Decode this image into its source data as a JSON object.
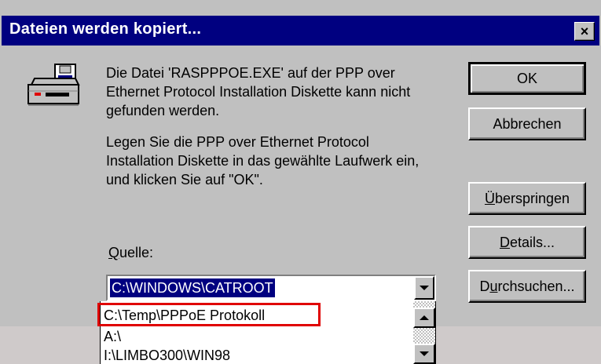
{
  "window": {
    "title": "Dateien werden kopiert...",
    "close_label": "×"
  },
  "message": {
    "line1": "Die Datei 'RASPPPOE.EXE' auf der PPP over Ethernet Protocol Installation Diskette kann nicht gefunden werden.",
    "line2": "Legen Sie die PPP over Ethernet Protocol Installation Diskette in das gewählte Laufwerk ein, und klicken Sie auf \"OK\"."
  },
  "buttons": {
    "ok": "OK",
    "cancel": "Abbrechen",
    "skip": {
      "accel": "Ü",
      "rest": "berspringen"
    },
    "details": {
      "accel": "D",
      "rest": "etails..."
    },
    "browse": {
      "pre": "D",
      "accel": "u",
      "rest": "rchsuchen..."
    }
  },
  "source": {
    "label_accel": "Q",
    "label_rest": "uelle:",
    "selected": "C:\\WINDOWS\\CATROOT",
    "options": [
      "C:\\Temp\\PPPoE Protokoll",
      "A:\\",
      "I:\\LIMBO300\\WIN98"
    ]
  },
  "colors": {
    "titlebar": "#000080",
    "face": "#c0c0c0",
    "highlight_box": "#e00000"
  },
  "icons": [
    "floppy-drive-icon",
    "close-icon",
    "dropdown-arrow-icon",
    "scroll-up-icon",
    "scroll-down-icon"
  ]
}
